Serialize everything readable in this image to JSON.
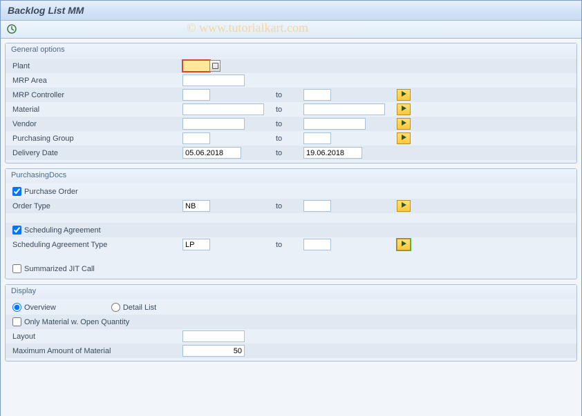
{
  "title": "Backlog List MM",
  "watermark": "© www.tutorialkart.com",
  "groups": {
    "general": {
      "title": "General options",
      "plant_label": "Plant",
      "mrp_area_label": "MRP Area",
      "mrp_controller_label": "MRP Controller",
      "material_label": "Material",
      "vendor_label": "Vendor",
      "purch_group_label": "Purchasing Group",
      "delivery_date_label": "Delivery Date",
      "to_label": "to",
      "delivery_date_from": "05.06.2018",
      "delivery_date_to": "19.06.2018"
    },
    "purchasing": {
      "title": "PurchasingDocs",
      "purchase_order_label": "Purchase Order",
      "purchase_order_checked": true,
      "order_type_label": "Order Type",
      "order_type_from": "NB",
      "to_label": "to",
      "scheduling_agreement_label": "Scheduling Agreement",
      "scheduling_agreement_checked": true,
      "sa_type_label": "Scheduling Agreement Type",
      "sa_type_from": "LP",
      "summarized_jit_label": "Summarized JIT Call",
      "summarized_jit_checked": false
    },
    "display": {
      "title": "Display",
      "overview_label": "Overview",
      "detail_list_label": "Detail List",
      "view_mode": "overview",
      "only_material_open_label": "Only Material w. Open Quantity",
      "only_material_open_checked": false,
      "layout_label": "Layout",
      "max_material_label": "Maximum Amount of Material",
      "max_material_value": "50"
    }
  }
}
